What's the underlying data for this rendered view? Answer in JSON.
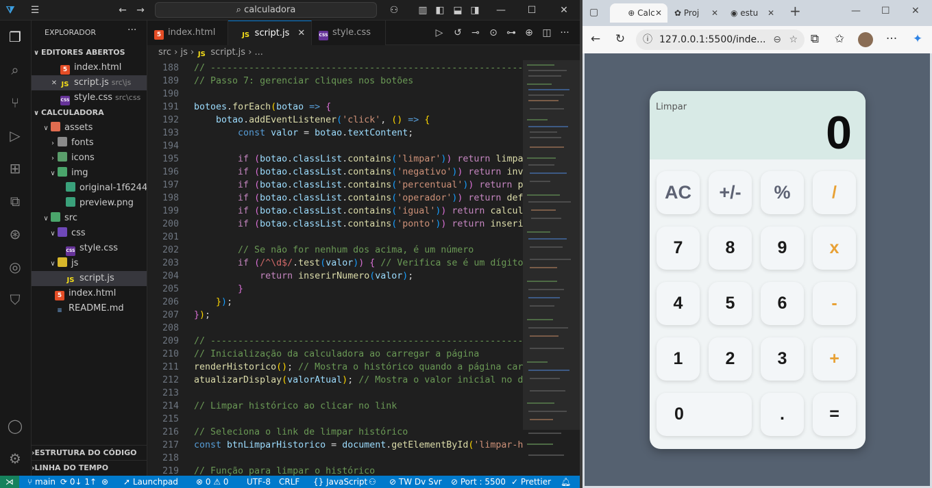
{
  "vscode": {
    "command_center": "calculadora",
    "explorer_title": "EXPLORADOR",
    "open_editors_title": "EDITORES ABERTOS",
    "open_editors": [
      {
        "name": "index.html",
        "path": ""
      },
      {
        "name": "script.js",
        "path": "src\\js"
      },
      {
        "name": "style.css",
        "path": "src\\css"
      }
    ],
    "project_title": "CALCULADORA",
    "tree": [
      "assets",
      "fonts",
      "icons",
      "img",
      "original-1f6244...",
      "preview.png",
      "src",
      "css",
      "style.css",
      "js",
      "script.js",
      "index.html",
      "README.md"
    ],
    "outline_title": "ESTRUTURA DO CÓDIGO",
    "timeline_title": "LINHA DO TEMPO",
    "tabs": [
      "index.html",
      "script.js",
      "style.css"
    ],
    "breadcrumb": [
      "src",
      "js",
      "script.js",
      "..."
    ],
    "line_numbers": [
      "188",
      "189",
      "190",
      "191",
      "192",
      "193",
      "194",
      "195",
      "196",
      "197",
      "198",
      "199",
      "200",
      "201",
      "202",
      "203",
      "204",
      "205",
      "206",
      "207",
      "208",
      "209",
      "210",
      "211",
      "212",
      "213",
      "214",
      "215",
      "216",
      "217",
      "218",
      "219"
    ],
    "status": {
      "branch": "main",
      "sync": "0↓ 1↑",
      "launchpad": "Launchpad",
      "problems": "0",
      "warnings": "0",
      "encoding": "UTF-8",
      "eol": "CRLF",
      "language": "JavaScript",
      "tw": "TW Dv Svr",
      "port": "Port : 5500",
      "prettier": "Prettier"
    }
  },
  "browser": {
    "tabs": [
      "Calc",
      "Proj",
      "estu"
    ],
    "url": "127.0.0.1:5500/inde...",
    "calculator": {
      "clear_link": "Limpar",
      "display": "0",
      "keys": [
        "AC",
        "+/-",
        "%",
        "/",
        "7",
        "8",
        "9",
        "x",
        "4",
        "5",
        "6",
        "-",
        "1",
        "2",
        "3",
        "+",
        "0",
        ".",
        "="
      ]
    }
  }
}
